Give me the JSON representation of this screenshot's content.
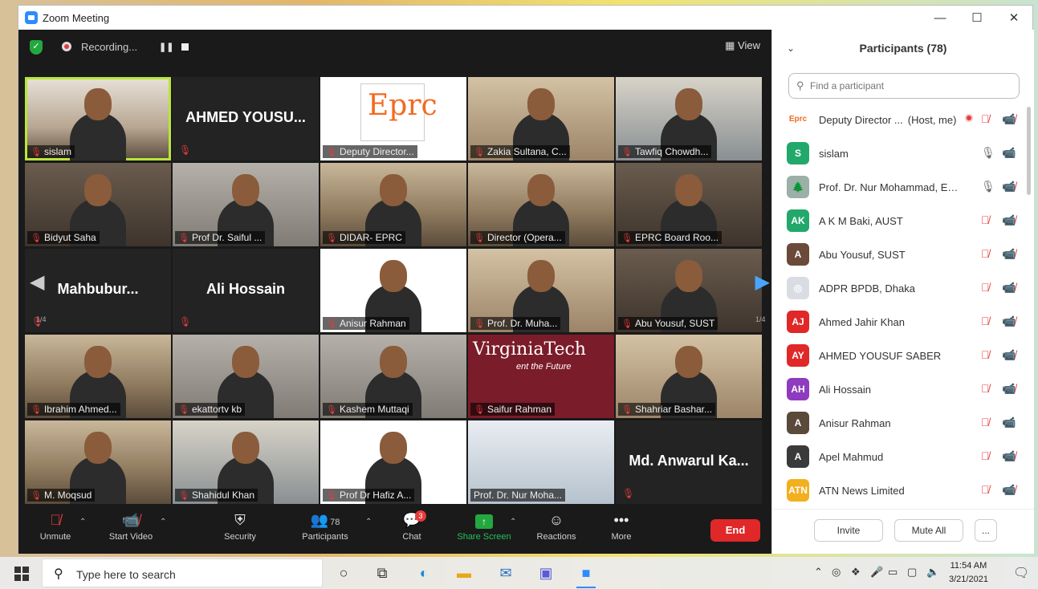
{
  "window": {
    "title": "Zoom Meeting",
    "controls": [
      "—",
      "☐",
      "✕"
    ]
  },
  "topbar": {
    "recording": "Recording...",
    "view": "View",
    "pause": "❚❚"
  },
  "tiles": [
    {
      "label": "sislam",
      "scene": "shelf",
      "active": true
    },
    {
      "big": "AHMED  YOUSU...",
      "scene": "dark-name"
    },
    {
      "label": "Deputy Director...",
      "scene": "logo"
    },
    {
      "label": "Zakia Sultana, C...",
      "scene": "room"
    },
    {
      "label": "Tawfiq Chowdh...",
      "scene": "books"
    },
    {
      "label": "Bidyut Saha",
      "scene": "dark"
    },
    {
      "label": "Prof Dr. Saiful ...",
      "scene": "grey"
    },
    {
      "label": "DIDAR- EPRC",
      "scene": "office"
    },
    {
      "label": "Director (Opera...",
      "scene": "office"
    },
    {
      "label": "EPRC Board Roo...",
      "scene": "dark"
    },
    {
      "big": "Mahbubur...",
      "scene": "dark-name"
    },
    {
      "big": "Ali Hossain",
      "scene": "dark-name"
    },
    {
      "label": "Anisur Rahman",
      "scene": "logo"
    },
    {
      "label": "Prof. Dr. Muha...",
      "scene": "room"
    },
    {
      "label": "Abu Yousuf, SUST",
      "scene": "dark"
    },
    {
      "label": "Ibrahim Ahmed...",
      "scene": "office"
    },
    {
      "label": "ekattortv kb",
      "scene": "grey"
    },
    {
      "label": "Kashem Muttaqi",
      "scene": "grey"
    },
    {
      "label": "Saifur Rahman",
      "scene": "vt"
    },
    {
      "label": "Shahriar Bashar...",
      "scene": "room"
    },
    {
      "label": "M. Moqsud",
      "scene": "office"
    },
    {
      "label": "Shahidul Khan",
      "scene": "books"
    },
    {
      "label": "Prof Dr Hafiz A...",
      "scene": "logo"
    },
    {
      "label": "Prof. Dr. Nur Moha...",
      "scene": "tower"
    },
    {
      "big": "Md. Anwarul Ka...",
      "scene": "dark-name"
    }
  ],
  "tile_texts": {
    "eprc_logo": "Eprc",
    "vt_title": "VirginiaTech",
    "vt_sub": "ent the Future"
  },
  "pages": {
    "left": "1/4",
    "right": "1/4"
  },
  "toolbar": {
    "unmute": "Unmute",
    "start_video": "Start Video",
    "security": "Security",
    "participants": "Participants",
    "participants_count": "78",
    "chat": "Chat",
    "chat_badge": "3",
    "share_screen": "Share Screen",
    "reactions": "Reactions",
    "more": "More",
    "end": "End"
  },
  "panel": {
    "title": "Participants (78)",
    "search_placeholder": "Find a participant",
    "invite": "Invite",
    "mute_all": "Mute All",
    "more": "...",
    "participants": [
      {
        "initials": "Eprc",
        "color": "#ffffff",
        "name": "Deputy Director ...",
        "suffix": "(Host, me)",
        "mic": "muted",
        "cam": "off",
        "recording": true
      },
      {
        "initials": "S",
        "color": "#23a86b",
        "name": "sislam",
        "mic": "on",
        "cam": "on"
      },
      {
        "initials": "🌲",
        "color": "#9bb0a6",
        "name": "Prof. Dr. Nur Mohammad, EEE C...",
        "mic": "on",
        "cam": "off"
      },
      {
        "initials": "AK",
        "color": "#23a86b",
        "name": "A K M Baki, AUST",
        "mic": "muted",
        "cam": "off"
      },
      {
        "initials": "A",
        "color": "#6b4a3a",
        "name": "Abu Yousuf, SUST",
        "mic": "muted",
        "cam": "off"
      },
      {
        "initials": "◎",
        "color": "#d9dde3",
        "name": "ADPR BPDB, Dhaka",
        "mic": "muted",
        "cam": "off"
      },
      {
        "initials": "AJ",
        "color": "#e02828",
        "name": "Ahmed Jahir Khan",
        "mic": "muted",
        "cam": "off"
      },
      {
        "initials": "AY",
        "color": "#e02828",
        "name": "AHMED YOUSUF SABER",
        "mic": "muted",
        "cam": "off"
      },
      {
        "initials": "AH",
        "color": "#8e3bbf",
        "name": "Ali Hossain",
        "mic": "muted",
        "cam": "off"
      },
      {
        "initials": "A",
        "color": "#5a4a3a",
        "name": "Anisur Rahman",
        "mic": "muted",
        "cam": "on"
      },
      {
        "initials": "A",
        "color": "#3a3a3a",
        "name": "Apel Mahmud",
        "mic": "muted",
        "cam": "off"
      },
      {
        "initials": "ATN",
        "color": "#f2b01e",
        "name": "ATN News Limited",
        "mic": "muted",
        "cam": "off"
      }
    ]
  },
  "taskbar": {
    "search": "Type here to search",
    "time": "11:54 AM",
    "date": "3/21/2021"
  },
  "colors": {
    "accent": "#2d8cff",
    "active_speaker": "#b7e63b",
    "end": "#e02828",
    "muted": "#e63b3b",
    "share": "#23a83f"
  }
}
